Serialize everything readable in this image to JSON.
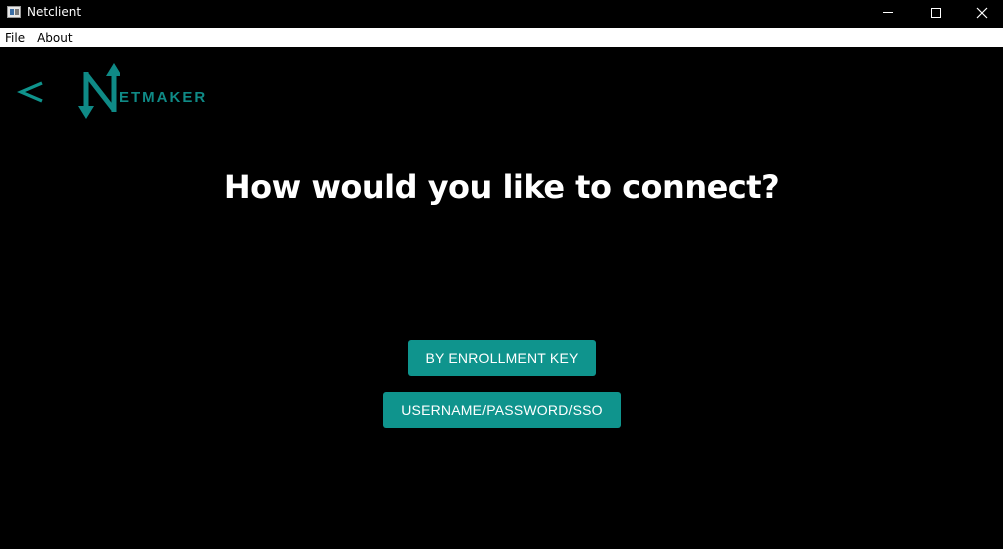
{
  "window": {
    "title": "Netclient",
    "controls": [
      "minimize-icon",
      "maximize-icon",
      "close-icon"
    ]
  },
  "menubar": {
    "items": [
      {
        "label": "File"
      },
      {
        "label": "About"
      }
    ]
  },
  "header": {
    "back_icon": "chevron-left-icon",
    "logo_text": "ETMAKER"
  },
  "main": {
    "heading": "How would you like to connect?",
    "buttons": [
      {
        "label": "BY ENROLLMENT KEY"
      },
      {
        "label": "USERNAME/PASSWORD/SSO"
      }
    ]
  },
  "colors": {
    "background": "#000000",
    "accent": "#0f948d",
    "logo": "#0f8a86",
    "text": "#ffffff"
  }
}
